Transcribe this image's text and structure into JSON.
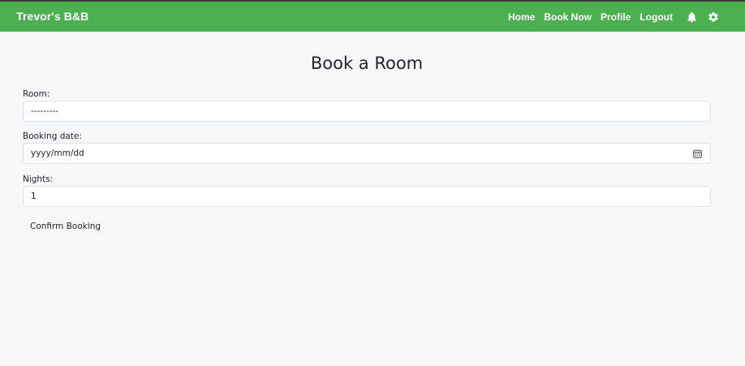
{
  "navbar": {
    "brand": "Trevor's B&B",
    "links": [
      {
        "label": "Home"
      },
      {
        "label": "Book Now"
      },
      {
        "label": "Profile"
      },
      {
        "label": "Logout"
      }
    ],
    "icons": [
      "bell-icon",
      "gear-icon"
    ],
    "background_color": "#4caf50"
  },
  "main": {
    "title": "Book a Room",
    "fields": {
      "room": {
        "label": "Room:",
        "value": "---------"
      },
      "booking_date": {
        "label": "Booking date:",
        "placeholder": "yyyy/mm/dd",
        "icon": "calendar-icon"
      },
      "nights": {
        "label": "Nights:",
        "value": "1"
      }
    },
    "confirm_label": "Confirm Booking"
  }
}
